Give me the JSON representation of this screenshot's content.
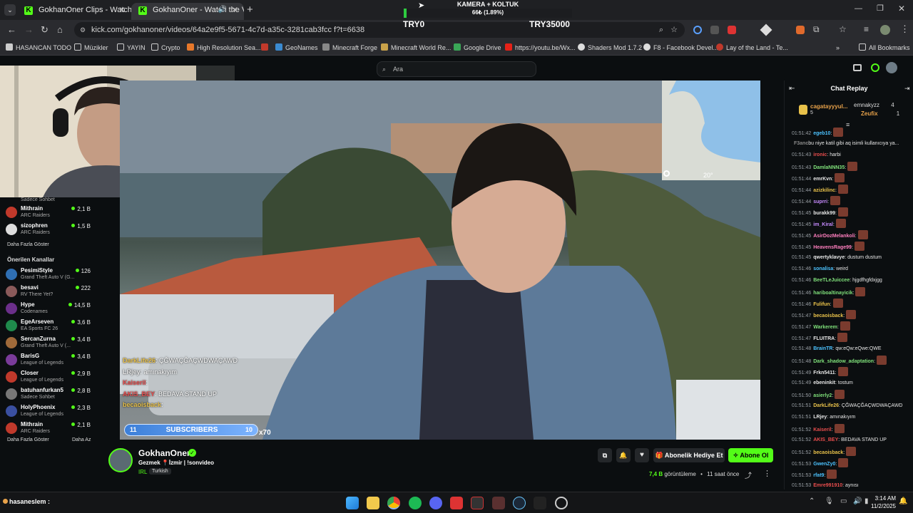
{
  "browser": {
    "tabs": [
      {
        "label": "GokhanOner Clips - Watch Live"
      },
      {
        "label": "GokhanOner - Watch the V"
      }
    ],
    "url": "kick.com/gokhanoner/videos/64a2e9f5-5671-4c7d-a35c-3281cab3fcc f?t=6638",
    "bookmarks": [
      "HASANCAN TODO",
      "Müzikler",
      "YAYIN",
      "Crypto",
      "High Resolution Sea...",
      "GeoNames",
      "Minecraft Forge",
      "Minecraft World Re...",
      "Google Drive",
      "https://youtu.be/Wx...",
      "Shaders Mod 1.7.2",
      "F8 - Facebook Devel...",
      "Lay of the Land - Te..."
    ],
    "all_bookmarks": "All Bookmarks"
  },
  "overlay_top": {
    "title": "KAMERA + KOLTUK",
    "progress_text": "66₺ (1.89%)",
    "progress": 0.0189,
    "left": "TRY0",
    "right": "TRY35000"
  },
  "search": {
    "placeholder": "Ara"
  },
  "sidebar": {
    "first_channel_game": "Sadece Sohbet",
    "channels_top": [
      {
        "name": "Mithrain",
        "game": "ARC Raiders",
        "viewers": "2,1 B",
        "color": "#c0392b"
      },
      {
        "name": "sizophren",
        "game": "ARC Raiders",
        "viewers": "1,5 B",
        "color": "#ddd"
      }
    ],
    "show_more": "Daha Fazla Göster",
    "recommended_title": "Önerilen Kanallar",
    "recommended": [
      {
        "name": "PesimiStyle",
        "game": "Grand Theft Auto V (G...",
        "viewers": "126",
        "color": "#2f6fb3"
      },
      {
        "name": "besavi",
        "game": "RV There Yet?",
        "viewers": "222",
        "color": "#8a5a5a"
      },
      {
        "name": "Hype",
        "game": "Codenames",
        "viewers": "14,5 B",
        "color": "#6b2f8a"
      },
      {
        "name": "EgeArseven",
        "game": "EA Sports FC 26",
        "viewers": "3,6 B",
        "color": "#1f8a4c"
      },
      {
        "name": "SercanZurna",
        "game": "Grand Theft Auto V (...",
        "viewers": "3,4 B",
        "color": "#a06a3a"
      },
      {
        "name": "BarisG",
        "game": "League of Legends",
        "viewers": "3,4 B",
        "color": "#7a3b9a"
      },
      {
        "name": "Closer",
        "game": "League of Legends",
        "viewers": "2,9 B",
        "color": "#c0392b"
      },
      {
        "name": "batuhanfurkan5",
        "game": "Sadece Sohbet",
        "viewers": "2,8 B",
        "color": "#777"
      },
      {
        "name": "HolyPhoenix",
        "game": "League of Legends",
        "viewers": "2,3 B",
        "color": "#3a4fa0"
      },
      {
        "name": "Mithrain",
        "game": "ARC Raiders",
        "viewers": "2,1 B",
        "color": "#c0392b"
      }
    ],
    "show_more_2": "Daha Fazla Göster",
    "show_less": "Daha Az"
  },
  "video_overlay": {
    "chat": [
      {
        "user": "DarkLife26",
        "text": ": ÇĞWAÇĞAÇWDWAÇAWD",
        "color": "#e8c14a"
      },
      {
        "user": "LRjey",
        "text": ": amınakıyım",
        "color": "#e6e6e6"
      },
      {
        "user": "Kaiseril",
        "text": ":",
        "color": "#e84d4d"
      },
      {
        "user": "AKIS_BEY",
        "text": ": BEDAVA STAND UP",
        "color": "#e84d4d"
      },
      {
        "user": "becaoisback",
        "text": ":",
        "color": "#e8c14a"
      }
    ],
    "subs_left": "11",
    "subs_label": "SUBSCRIBERS",
    "subs_right": "10",
    "multiplier": "x70",
    "map_temp": "20°"
  },
  "channel": {
    "name": "GokhanOner",
    "title": "Gezmek 📍İzmir | !sonvideo",
    "category": "IRL",
    "tag": "Turkish",
    "gift_label": "Abonelik Hediye Et",
    "subscribe_label": "Abone Ol",
    "views": "7,4 B",
    "views_label": "görüntüleme",
    "ago": "11 saat önce"
  },
  "chat": {
    "title": "Chat Replay",
    "top_gifter": {
      "name": "cagatayyyul...",
      "count": "5"
    },
    "gifters": [
      {
        "name": "emnakyzz",
        "count": "4"
      },
      {
        "name": "Zeufix",
        "count": "1"
      }
    ],
    "messages": [
      {
        "t": "01:51:42",
        "u": "egeb10",
        "x": ":",
        "c": "#4cc3ff"
      },
      {
        "t": "",
        "u": "F3anc",
        "x": "bu niye katil gibi aq isimli kullanıcıya ya...",
        "c": "#888"
      },
      {
        "t": "01:51:43",
        "u": "ironic",
        "x": ": harbi",
        "c": "#e84d4d"
      },
      {
        "t": "01:51:43",
        "u": "DamlaNNN35",
        "x": ":",
        "c": "#7fe07a"
      },
      {
        "t": "01:51:44",
        "u": "emrKvn",
        "x": ":",
        "c": "#e6e6e6"
      },
      {
        "t": "01:51:44",
        "u": "azizkilinc",
        "x": ":",
        "c": "#e8c14a"
      },
      {
        "t": "01:51:44",
        "u": "suprri",
        "x": ":",
        "c": "#c78bff"
      },
      {
        "t": "01:51:45",
        "u": "burakk99",
        "x": ":",
        "c": "#e6e6e6"
      },
      {
        "t": "01:51:45",
        "u": "im_Kiral",
        "x": ":",
        "c": "#c78bff"
      },
      {
        "t": "01:51:45",
        "u": "AsirDozMelankoli",
        "x": ":",
        "c": "#ff7fbf"
      },
      {
        "t": "01:51:45",
        "u": "HeavensRage99",
        "x": ":",
        "c": "#ff7fbf"
      },
      {
        "t": "01:51:45",
        "u": "qwertyklavye",
        "x": ": dustum dustum",
        "c": "#e6e6e6"
      },
      {
        "t": "01:51:46",
        "u": "sonalisa",
        "x": ": weird",
        "c": "#4cc3ff"
      },
      {
        "t": "01:51:46",
        "u": "BeeTLeJuiccee",
        "x": ": hjgdfhgfdxjgg",
        "c": "#7fe07a"
      },
      {
        "t": "01:51:46",
        "u": "hariboaltinayicik",
        "x": ":",
        "c": "#7fe07a"
      },
      {
        "t": "01:51:46",
        "u": "Fulifun",
        "x": ":",
        "c": "#e8c14a"
      },
      {
        "t": "01:51:47",
        "u": "becaoisback",
        "x": ":",
        "c": "#e8c14a"
      },
      {
        "t": "01:51:47",
        "u": "Warkerem",
        "x": ":",
        "c": "#7fe07a"
      },
      {
        "t": "01:51:47",
        "u": "FLUITRA",
        "x": ":",
        "c": "#e6e6e6"
      },
      {
        "t": "01:51:48",
        "u": "BrainTR",
        "x": ": qw:eQw:eQwe:QWE",
        "c": "#4cc3ff"
      },
      {
        "t": "01:51:48",
        "u": "Dark_shadow_adaptation",
        "x": ":",
        "c": "#7fe07a"
      },
      {
        "t": "01:51:49",
        "u": "Frkn5411",
        "x": ":",
        "c": "#e6e6e6"
      },
      {
        "t": "01:51:49",
        "u": "ebeninkit",
        "x": ": tostum",
        "c": "#e6e6e6"
      },
      {
        "t": "01:51:50",
        "u": "asierly2",
        "x": ":",
        "c": "#7fe07a"
      },
      {
        "t": "01:51:51",
        "u": "DarkLife26",
        "x": ": ÇĞWAÇĞAÇWDWAÇAWD",
        "c": "#e8c14a"
      },
      {
        "t": "01:51:51",
        "u": "LRjey",
        "x": ": amınakıyım",
        "c": "#e6e6e6"
      },
      {
        "t": "01:51:52",
        "u": "Kaiseril",
        "x": ":",
        "c": "#e84d4d"
      },
      {
        "t": "01:51:52",
        "u": "AKIS_BEY",
        "x": ": BEDAVA STAND UP",
        "c": "#e84d4d"
      },
      {
        "t": "01:51:52",
        "u": "becaoisback",
        "x": ":",
        "c": "#e8c14a"
      },
      {
        "t": "01:51:53",
        "u": "GwenZy0",
        "x": ":",
        "c": "#4cc3ff"
      },
      {
        "t": "01:51:53",
        "u": "rfat9",
        "x": ":",
        "c": "#4cc3ff"
      },
      {
        "t": "01:51:53",
        "u": "Emre991910",
        "x": ": aynısı",
        "c": "#e84d4d"
      }
    ]
  },
  "taskbar": {
    "user": "hasaneslem :",
    "time": "3:14 AM",
    "date": "11/2/2025"
  }
}
